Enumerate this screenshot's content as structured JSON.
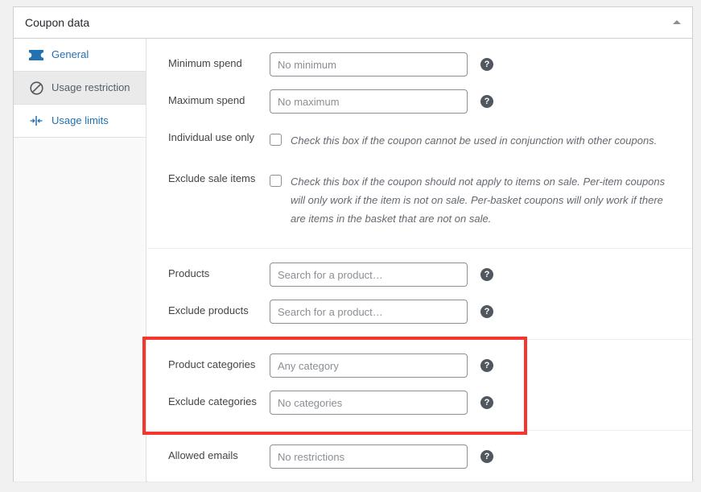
{
  "panel": {
    "title": "Coupon data",
    "toggle_icon": "triangle-up-icon"
  },
  "sidebar": {
    "items": [
      {
        "label": "General",
        "icon": "ticket-icon",
        "active": false
      },
      {
        "label": "Usage restriction",
        "icon": "no-entry-icon",
        "active": true
      },
      {
        "label": "Usage limits",
        "icon": "usage-limits-icon",
        "active": false
      }
    ]
  },
  "fields": {
    "groups": [
      {
        "rows": [
          {
            "type": "input",
            "label": "Minimum spend",
            "placeholder": "No minimum",
            "value": "",
            "help": "?"
          },
          {
            "type": "input",
            "label": "Maximum spend",
            "placeholder": "No maximum",
            "value": "",
            "help": "?"
          },
          {
            "type": "checkbox",
            "label": "Individual use only",
            "checked": false,
            "description": "Check this box if the coupon cannot be used in conjunction with other coupons."
          },
          {
            "type": "checkbox",
            "label": "Exclude sale items",
            "checked": false,
            "description": "Check this box if the coupon should not apply to items on sale. Per-item coupons will only work if the item is not on sale. Per-basket coupons will only work if there are items in the basket that are not on sale."
          }
        ]
      },
      {
        "rows": [
          {
            "type": "input",
            "label": "Products",
            "placeholder": "Search for a product…",
            "value": "",
            "help": "?"
          },
          {
            "type": "input",
            "label": "Exclude products",
            "placeholder": "Search for a product…",
            "value": "",
            "help": "?"
          }
        ]
      },
      {
        "rows": [
          {
            "type": "input",
            "label": "Product categories",
            "placeholder": "Any category",
            "value": "",
            "help": "?"
          },
          {
            "type": "input",
            "label": "Exclude categories",
            "placeholder": "No categories",
            "value": "",
            "help": "?"
          }
        ]
      },
      {
        "rows": [
          {
            "type": "input",
            "label": "Allowed emails",
            "placeholder": "No restrictions",
            "value": "",
            "help": "?"
          }
        ]
      }
    ]
  },
  "annotation": {
    "color": "#f4362c",
    "highlights": "product-categories-and-exclude-categories"
  },
  "colors": {
    "link": "#2271b1",
    "icon_blue": "#2271b1",
    "label": "#444444",
    "placeholder": "#8a8f94",
    "panel_border": "#ccd0d4",
    "active_tab_bg": "#eaeaea",
    "page_bg": "#f1f1f1"
  }
}
